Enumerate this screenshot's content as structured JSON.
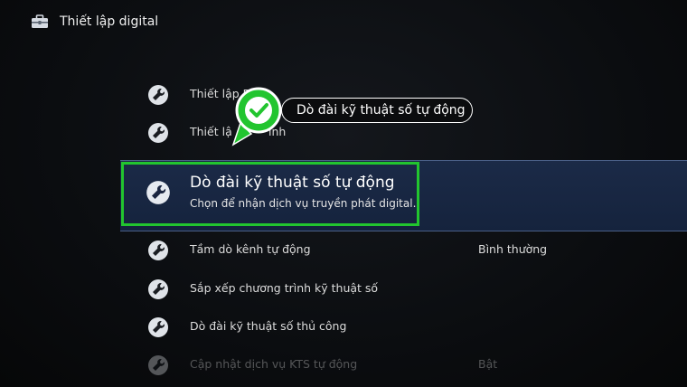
{
  "header": {
    "title": "Thiết lập digital",
    "icon": "toolbox-icon"
  },
  "menu": {
    "items_above": [
      {
        "label": "Thiết lập P",
        "icon": "wrench-icon"
      },
      {
        "label": "Thiết lậ",
        "label_tail": "ình",
        "icon": "wrench-icon"
      }
    ],
    "selected": {
      "title": "Dò đài kỹ thuật số tự động",
      "description": "Chọn để nhận dịch vụ truyền phát digital.",
      "icon": "wrench-icon"
    },
    "items_below": [
      {
        "label": "Tầm dò kênh tự động",
        "value": "Bình thường",
        "icon": "wrench-icon"
      },
      {
        "label": "Sắp xếp chương trình kỹ thuật số",
        "icon": "wrench-icon"
      },
      {
        "label": "Dò đài kỹ thuật số thủ công",
        "icon": "wrench-icon"
      },
      {
        "label": "Cập nhật dịch vụ KTS tự động",
        "value": "Bật",
        "icon": "wrench-icon"
      }
    ]
  },
  "annotation": {
    "callout_text": "Dò đài kỹ thuật số tự động",
    "marker_icon": "check-pin-icon",
    "highlight_color": "#22c52f",
    "selected_bg": "#1b2a47"
  }
}
